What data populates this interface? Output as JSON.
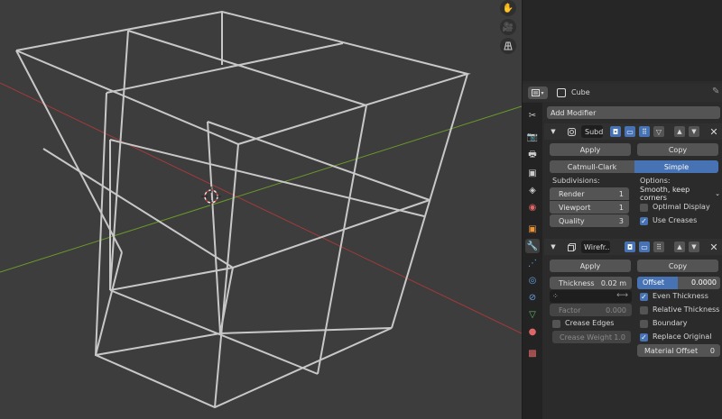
{
  "viewport": {
    "tools": [
      "hand-icon",
      "camera-icon",
      "grid-icon"
    ]
  },
  "header": {
    "object_name": "Cube"
  },
  "add_modifier": "Add Modifier",
  "subd": {
    "name": "Subd",
    "apply": "Apply",
    "copy": "Copy",
    "type_catmull": "Catmull-Clark",
    "type_simple": "Simple",
    "subdivisions_label": "Subdivisions:",
    "options_label": "Options:",
    "render_label": "Render",
    "render_value": "1",
    "viewport_label": "Viewport",
    "viewport_value": "1",
    "quality_label": "Quality",
    "quality_value": "3",
    "uv_smooth": "Smooth, keep corners",
    "optimal_display": "Optimal Display",
    "use_creases": "Use Creases"
  },
  "wire": {
    "name": "Wirefr..",
    "apply": "Apply",
    "copy": "Copy",
    "thickness_label": "Thickness",
    "thickness_value": "0.02 m",
    "offset_label": "Offset",
    "offset_value": "0.0000",
    "even_thickness": "Even Thickness",
    "factor_label": "Factor",
    "factor_value": "0.000",
    "relative_thickness": "Relative Thickness",
    "crease_edges": "Crease Edges",
    "boundary": "Boundary",
    "crease_weight_label": "Crease Weight",
    "crease_weight_value": "1.0",
    "replace_original": "Replace Original",
    "material_offset_label": "Material Offset",
    "material_offset_value": "0"
  },
  "colors": {
    "accent": "#4772b3",
    "x_axis": "#a33a3a",
    "y_axis": "#6b9a2a"
  }
}
